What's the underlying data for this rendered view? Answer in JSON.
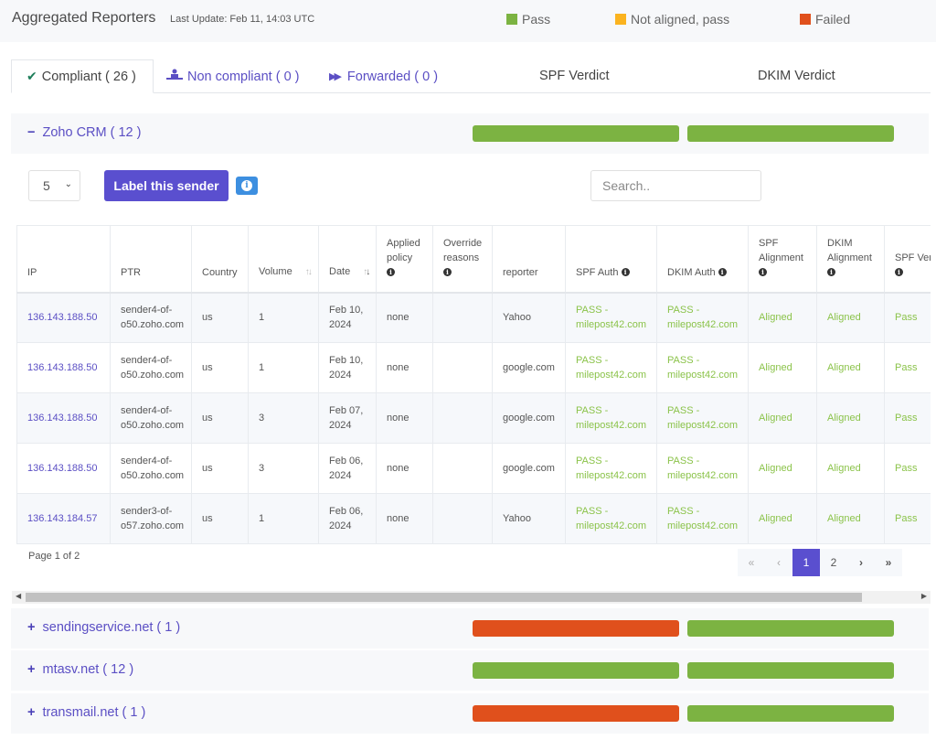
{
  "header": {
    "title": "Aggregated Reporters",
    "last_update": "Last Update: Feb 11, 14:03 UTC",
    "legend": [
      {
        "label": "Pass",
        "color": "#7cb342"
      },
      {
        "label": "Not aligned, pass",
        "color": "#fbb31f"
      },
      {
        "label": "Failed",
        "color": "#e0501c"
      }
    ]
  },
  "tabs": [
    {
      "label": "Compliant ( 26 )",
      "icon": "check-icon",
      "active": true
    },
    {
      "label": "Non compliant ( 0 )",
      "icon": "person-at-desk-icon",
      "active": false
    },
    {
      "label": "Forwarded ( 0 )",
      "icon": "fast-forward-icon",
      "active": false
    }
  ],
  "verdict_headers": {
    "spf": "SPF Verdict",
    "dkim": "DKIM Verdict"
  },
  "groups": [
    {
      "name": "Zoho CRM ( 12 )",
      "expanded": true,
      "sign": "−",
      "spf_status": "pass",
      "dkim_status": "pass"
    },
    {
      "name": "sendingservice.net ( 1 )",
      "expanded": false,
      "sign": "+",
      "spf_status": "failed",
      "dkim_status": "pass"
    },
    {
      "name": "mtasv.net ( 12 )",
      "expanded": false,
      "sign": "+",
      "spf_status": "pass",
      "dkim_status": "pass"
    },
    {
      "name": "transmail.net ( 1 )",
      "expanded": false,
      "sign": "+",
      "spf_status": "failed",
      "dkim_status": "pass"
    }
  ],
  "status_colors": {
    "pass": "#7cb342",
    "failed": "#e0501c",
    "not_aligned_pass": "#fbb31f"
  },
  "controls": {
    "page_size": "5",
    "label_button": "Label this sender",
    "search_placeholder": "Search.."
  },
  "table": {
    "columns": [
      "IP",
      "PTR",
      "Country",
      "Volume",
      "Date",
      "Applied policy",
      "Override reasons",
      "reporter",
      "SPF Auth",
      "DKIM Auth",
      "SPF Alignment",
      "DKIM Alignment",
      "SPF Verdict"
    ],
    "rows": [
      {
        "ip": "136.143.188.50",
        "ptr": "sender4-of-o50.zoho.com",
        "country": "us",
        "volume": "1",
        "date": "Feb 10, 2024",
        "policy": "none",
        "override": "",
        "reporter": "Yahoo",
        "spf_auth": "PASS - milepost42.com",
        "dkim_auth": "PASS - milepost42.com",
        "spf_align": "Aligned",
        "dkim_align": "Aligned",
        "spf_verdict": "Pass"
      },
      {
        "ip": "136.143.188.50",
        "ptr": "sender4-of-o50.zoho.com",
        "country": "us",
        "volume": "1",
        "date": "Feb 10, 2024",
        "policy": "none",
        "override": "",
        "reporter": "google.com",
        "spf_auth": "PASS - milepost42.com",
        "dkim_auth": "PASS - milepost42.com",
        "spf_align": "Aligned",
        "dkim_align": "Aligned",
        "spf_verdict": "Pass"
      },
      {
        "ip": "136.143.188.50",
        "ptr": "sender4-of-o50.zoho.com",
        "country": "us",
        "volume": "3",
        "date": "Feb 07, 2024",
        "policy": "none",
        "override": "",
        "reporter": "google.com",
        "spf_auth": "PASS - milepost42.com",
        "dkim_auth": "PASS - milepost42.com",
        "spf_align": "Aligned",
        "dkim_align": "Aligned",
        "spf_verdict": "Pass"
      },
      {
        "ip": "136.143.188.50",
        "ptr": "sender4-of-o50.zoho.com",
        "country": "us",
        "volume": "3",
        "date": "Feb 06, 2024",
        "policy": "none",
        "override": "",
        "reporter": "google.com",
        "spf_auth": "PASS - milepost42.com",
        "dkim_auth": "PASS - milepost42.com",
        "spf_align": "Aligned",
        "dkim_align": "Aligned",
        "spf_verdict": "Pass"
      },
      {
        "ip": "136.143.184.57",
        "ptr": "sender3-of-o57.zoho.com",
        "country": "us",
        "volume": "1",
        "date": "Feb 06, 2024",
        "policy": "none",
        "override": "",
        "reporter": "Yahoo",
        "spf_auth": "PASS - milepost42.com",
        "dkim_auth": "PASS - milepost42.com",
        "spf_align": "Aligned",
        "dkim_align": "Aligned",
        "spf_verdict": "Pass"
      }
    ]
  },
  "pagination": {
    "info": "Page 1 of 2",
    "first": "«",
    "prev": "‹",
    "pages": [
      "1",
      "2"
    ],
    "current": "1",
    "next": "›",
    "last": "»"
  }
}
